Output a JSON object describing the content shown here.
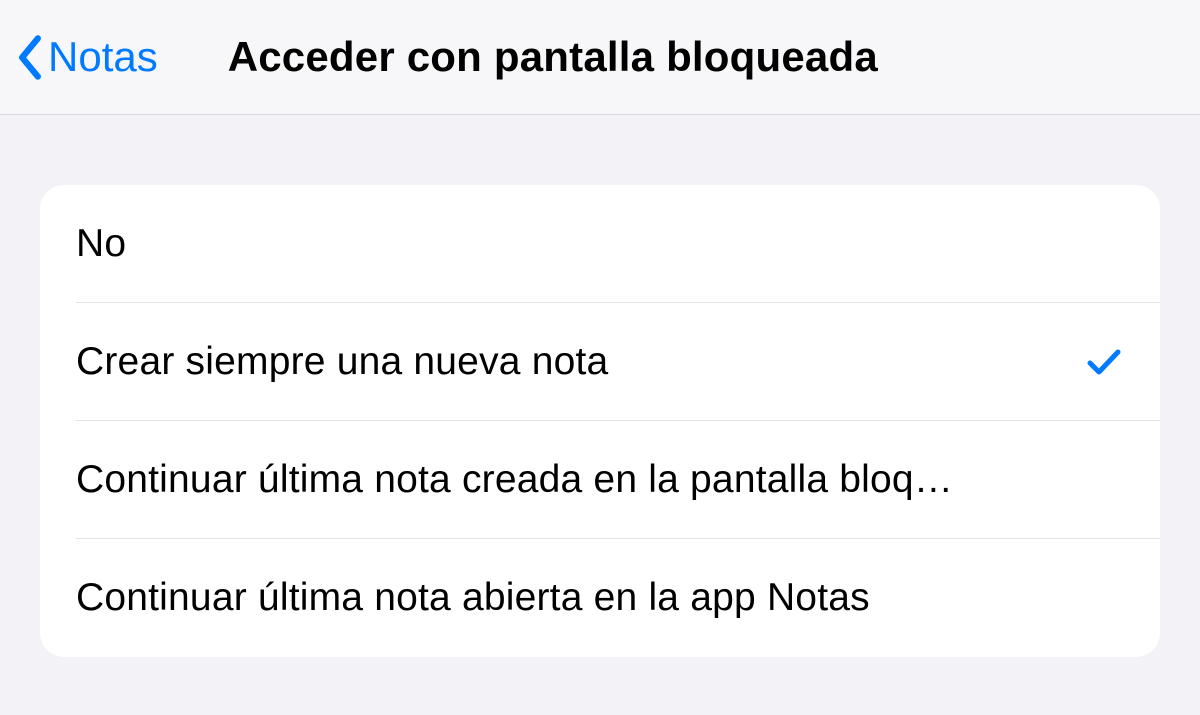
{
  "nav": {
    "back_label": "Notas",
    "title": "Acceder con pantalla bloqueada"
  },
  "options": [
    {
      "label": "No",
      "selected": false
    },
    {
      "label": "Crear siempre una nueva nota",
      "selected": true
    },
    {
      "label": "Continuar última nota creada en la pantalla bloq…",
      "selected": false
    },
    {
      "label": "Continuar última nota abierta en la app Notas",
      "selected": false
    }
  ],
  "colors": {
    "accent": "#007aff"
  }
}
